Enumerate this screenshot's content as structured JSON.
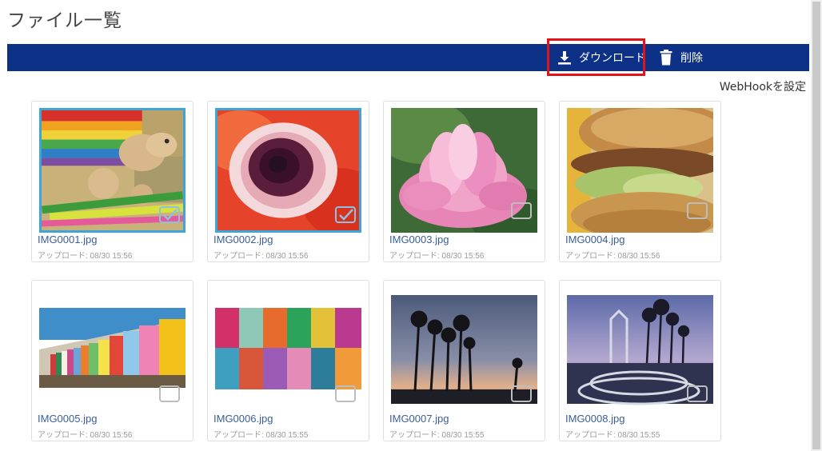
{
  "page": {
    "title": "ファイル一覧"
  },
  "toolbar": {
    "download_label": "ダウンロード",
    "delete_label": "削除",
    "bg_color": "#0c3187"
  },
  "webhook_label": "WebHookを設定",
  "files": [
    {
      "name": "IMG0001.jpg",
      "uploaded": "アップロード: 08/30 15:56",
      "selected": true
    },
    {
      "name": "IMG0002.jpg",
      "uploaded": "アップロード: 08/30 15:56",
      "selected": true
    },
    {
      "name": "IMG0003.jpg",
      "uploaded": "アップロード: 08/30 15:56",
      "selected": false
    },
    {
      "name": "IMG0004.jpg",
      "uploaded": "アップロード: 08/30 15:56",
      "selected": false
    },
    {
      "name": "IMG0005.jpg",
      "uploaded": "アップロード: 08/30 15:56",
      "selected": false
    },
    {
      "name": "IMG0006.jpg",
      "uploaded": "アップロード: 08/30 15:55",
      "selected": false
    },
    {
      "name": "IMG0007.jpg",
      "uploaded": "アップロード: 08/30 15:55",
      "selected": false
    },
    {
      "name": "IMG0008.jpg",
      "uploaded": "アップロード: 08/30 15:55",
      "selected": false
    }
  ],
  "colors": {
    "selection_border": "#3fa4d8",
    "highlight_box": "#e0141a",
    "filename": "#3a5d99"
  }
}
